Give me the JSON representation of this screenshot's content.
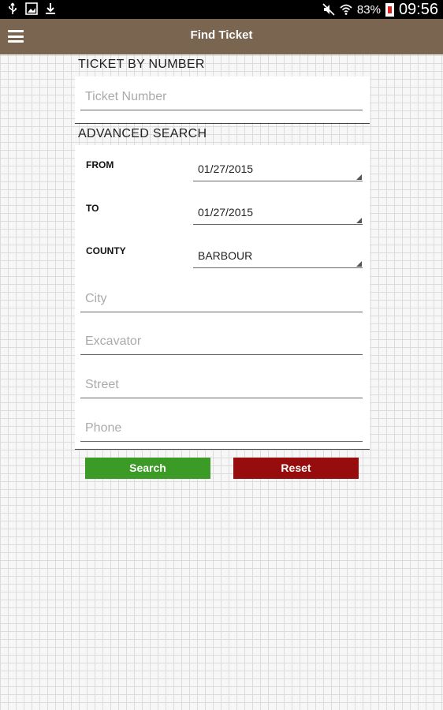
{
  "status_bar": {
    "battery_percent": "83%",
    "time": "09:56",
    "left_icons": [
      "usb-icon",
      "image-icon",
      "download-icon"
    ],
    "right_icons": [
      "mute-icon",
      "wifi-icon",
      "battery-icon"
    ]
  },
  "app_bar": {
    "title": "Find Ticket",
    "background_color": "#7a6551"
  },
  "ticket_by_number": {
    "header": "TICKET BY NUMBER",
    "ticket_number_placeholder": "Ticket Number"
  },
  "advanced_search": {
    "header": "ADVANCED SEARCH",
    "from_label": "FROM",
    "from_value": "01/27/2015",
    "to_label": "TO",
    "to_value": "01/27/2015",
    "county_label": "COUNTY",
    "county_value": "BARBOUR",
    "city_placeholder": "City",
    "excavator_placeholder": "Excavator",
    "street_placeholder": "Street",
    "phone_placeholder": "Phone"
  },
  "actions": {
    "search_label": "Search",
    "search_color": "#3c9a27",
    "reset_label": "Reset",
    "reset_color": "#970d0d"
  }
}
